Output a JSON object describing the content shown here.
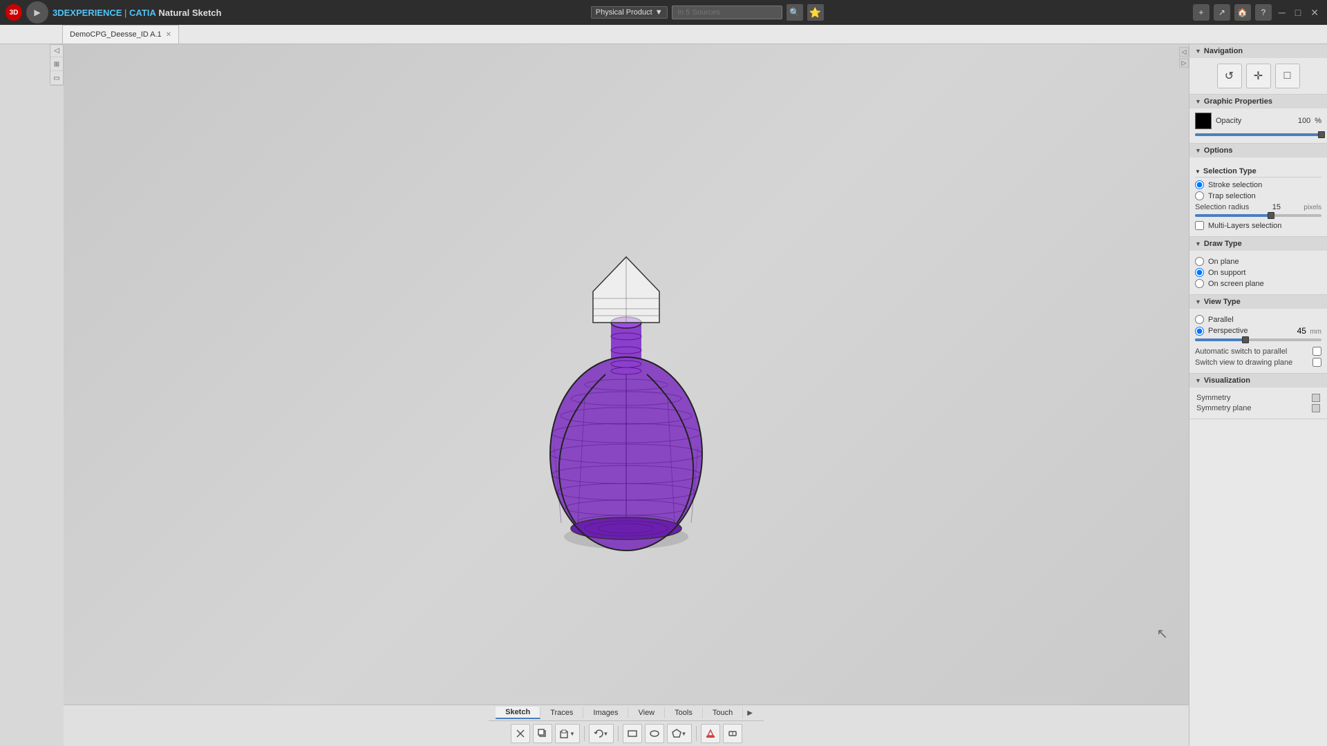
{
  "titleBar": {
    "appName": "3DEXPERIENCE",
    "catia": "CATIA",
    "module": "Natural Sketch",
    "productLabel": "Physical Product",
    "searchPlaceholder": "in 5 Sources",
    "minBtn": "─",
    "maxBtn": "□",
    "closeBtn": "✕"
  },
  "tabs": [
    {
      "label": "DemoCPG_Deesse_ID A.1",
      "active": true
    }
  ],
  "rightPanel": {
    "navigation": {
      "title": "Navigation",
      "undoIcon": "↺",
      "moveIcon": "✛",
      "fitIcon": "□"
    },
    "graphicProperties": {
      "title": "Graphic Properties",
      "opacityLabel": "Opacity",
      "opacityValue": "100",
      "opacityUnit": "%",
      "sliderPercent": 100
    },
    "options": {
      "title": "Options",
      "selectionType": {
        "title": "Selection Type",
        "strokeLabel": "Stroke selection",
        "trapLabel": "Trap selection",
        "strokeChecked": true,
        "trapChecked": false
      },
      "selectionRadius": {
        "label": "Selection radius",
        "value": "15",
        "unit": "pixels"
      },
      "multiLayersLabel": "Multi-Layers selection",
      "multiLayersChecked": false
    },
    "drawType": {
      "title": "Draw Type",
      "onPlaneLabel": "On plane",
      "onPlaneChecked": false,
      "onSupportLabel": "On support",
      "onSupportChecked": true,
      "onScreenPlaneLabel": "On screen plane",
      "onScreenPlaneChecked": false
    },
    "viewType": {
      "title": "View Type",
      "parallelLabel": "Parallel",
      "parallelChecked": false,
      "perspectiveLabel": "Perspective",
      "perspectiveChecked": true,
      "perspectiveValue": "45",
      "perspectiveUnit": "mm",
      "autoSwitchLabel": "Automatic switch to parallel",
      "autoSwitchChecked": false,
      "switchViewLabel": "Switch view to drawing plane",
      "switchViewChecked": false
    },
    "visualization": {
      "title": "Visualization",
      "symmetryLabel": "Symmetry",
      "symmetryChecked": false,
      "symmetryPlaneLabel": "Symmetry plane",
      "symmetryPlaneChecked": false
    }
  },
  "bottomToolbar": {
    "tabs": [
      {
        "label": "Sketch",
        "active": true
      },
      {
        "label": "Traces",
        "active": false
      },
      {
        "label": "Images",
        "active": false
      },
      {
        "label": "View",
        "active": false
      },
      {
        "label": "Tools",
        "active": false
      },
      {
        "label": "Touch",
        "active": false
      }
    ],
    "icons": [
      "✂",
      "📄",
      "⧉",
      "↺",
      "|",
      "⬛",
      "⬜",
      "◑",
      "|",
      "🔴",
      "🔵"
    ]
  }
}
